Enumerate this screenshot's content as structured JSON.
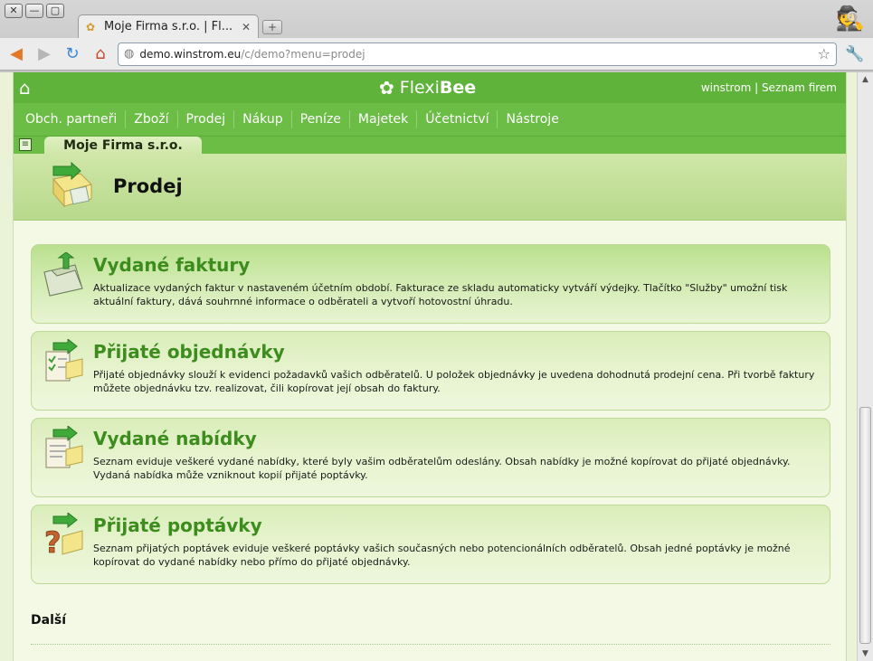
{
  "browser": {
    "tab_title": "Moje Firma s.r.o. | Fl...",
    "url_host": "demo.winstrom.eu",
    "url_path": "/c/demo?menu=prodej"
  },
  "app": {
    "logo_flexi": "Flexi",
    "logo_bee": "Bee",
    "user_link": "winstrom",
    "separator": " | ",
    "companies_link": "Seznam firem",
    "menu": [
      "Obch. partneři",
      "Zboží",
      "Prodej",
      "Nákup",
      "Peníze",
      "Majetek",
      "Účetnictví",
      "Nástroje"
    ],
    "company_tab": "Moje Firma s.r.o.",
    "page_title": "Prodej"
  },
  "cards": [
    {
      "title": "Vydané faktury",
      "desc": "Aktualizace vydaných faktur v nastaveném účetním období. Fakturace ze skladu automaticky vytváří výdejky. Tlačítko \"Služby\" umožní tisk aktuální faktury, dává souhrnné informace o odběrateli a vytvoří hotovostní úhradu."
    },
    {
      "title": "Přijaté objednávky",
      "desc": "Přijaté objednávky slouží k evidenci požadavků vašich odběratelů. U položek objednávky je uvedena dohodnutá prodejní cena. Při tvorbě faktury můžete objednávku tzv. realizovat, čili kopírovat její obsah do faktury."
    },
    {
      "title": "Vydané nabídky",
      "desc": "Seznam eviduje veškeré vydané nabídky, které byly vašim odběratelům odeslány. Obsah nabídky je možné kopírovat do přijaté objednávky. Vydaná nabídka může vzniknout kopií přijaté poptávky."
    },
    {
      "title": "Přijaté poptávky",
      "desc": "Seznam přijatých poptávek eviduje veškeré poptávky vašich současných nebo potencionálních odběratelů. Obsah jedné poptávky je možné kopírovat do vydané nabídky nebo přímo do přijaté objednávky."
    }
  ],
  "section_more": "Další",
  "colors": {
    "brand_green": "#5fb33a",
    "card_title": "#3c8c1e"
  }
}
